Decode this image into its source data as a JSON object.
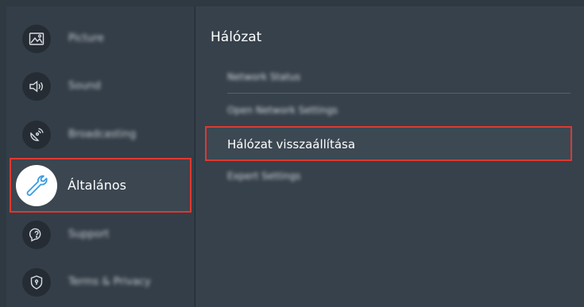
{
  "sidebar": {
    "items": [
      {
        "label": "Picture",
        "icon": "picture-icon"
      },
      {
        "label": "Sound",
        "icon": "sound-icon"
      },
      {
        "label": "Broadcasting",
        "icon": "broadcasting-icon"
      },
      {
        "label": "Általános",
        "icon": "wrench-icon",
        "selected": true
      },
      {
        "label": "Support",
        "icon": "support-icon"
      },
      {
        "label": "Terms & Privacy",
        "icon": "privacy-shield-icon"
      }
    ]
  },
  "main": {
    "title": "Hálózat",
    "options": [
      {
        "label": "Network Status"
      },
      {
        "label": "Open Network Settings"
      },
      {
        "label": "Hálózat visszaállítása",
        "selected": true
      },
      {
        "label": "Expert Settings"
      }
    ]
  },
  "colors": {
    "background": "#2f3942",
    "sidebar": "#343e48",
    "selection_border": "#e0382f",
    "text": "#ffffff"
  }
}
